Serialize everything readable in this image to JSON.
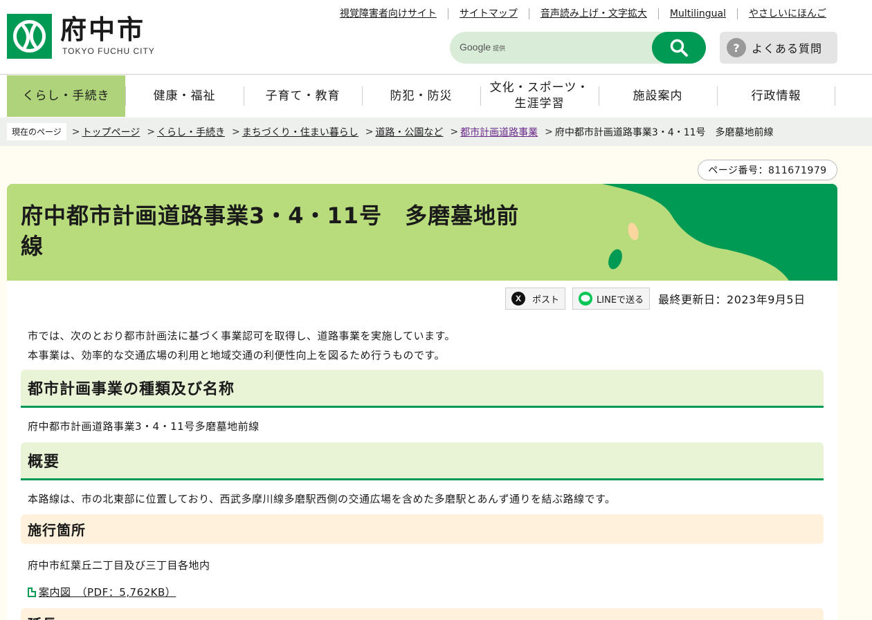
{
  "header": {
    "logo_title": "府中市",
    "logo_sub": "TOKYO FUCHU CITY",
    "util_links": [
      "視覚障害者向けサイト",
      "サイトマップ",
      "音声読み上げ・文字拡大",
      "Multilingual",
      "やさしいにほんご"
    ],
    "search": {
      "brand": "Google",
      "brand_sub": "提供",
      "placeholder": ""
    },
    "faq_label": "よくある質問",
    "faq_mark": "?"
  },
  "nav": {
    "items": [
      "くらし・手続き",
      "健康・福祉",
      "子育て・教育",
      "防犯・防災",
      "文化・スポーツ・生涯学習",
      "施設案内",
      "行政情報"
    ],
    "item_4_line1": "文化・スポーツ・",
    "item_4_line2": "生涯学習"
  },
  "breadcrumb": {
    "current_label": "現在のページ",
    "items": [
      "トップページ",
      "くらし・手続き",
      "まちづくり・住まい暮らし",
      "道路・公園など",
      "都市計画道路事業",
      "府中都市計画道路事業3・4・11号　多磨墓地前線"
    ],
    "sep": ">"
  },
  "page": {
    "number": "ページ番号：811671979",
    "title_line1": "府中都市計画道路事業3・4・11号　多磨墓地前",
    "title_line2": "線",
    "share_x": "ポスト",
    "share_line": "LINEで送る",
    "updated": "最終更新日：2023年9月5日",
    "intro_1": "市では、次のとおり都市計画法に基づく事業認可を取得し、道路事業を実施しています。",
    "intro_2": "本事業は、効率的な交通広場の利用と地域交通の利便性向上を図るため行うものです。",
    "h2_1": "都市計画事業の種類及び名称",
    "p_1": "府中都市計画道路事業3・4・11号多磨墓地前線",
    "h2_2": "概要",
    "p_2": "本路線は、市の北東部に位置しており、西武多摩川線多磨駅西側の交通広場を含めた多磨駅とあんず通りを結ぶ路線です。",
    "h3_1": "施行箇所",
    "p_3": "府中市紅葉丘二丁目及び三丁目各地内",
    "pdf_link": "案内図　（PDF：5,762KB）",
    "h3_2": "延長"
  },
  "colors": {
    "brand_green": "#009a55",
    "nav_active": "#aed37a",
    "banner": "#b8db7c"
  }
}
